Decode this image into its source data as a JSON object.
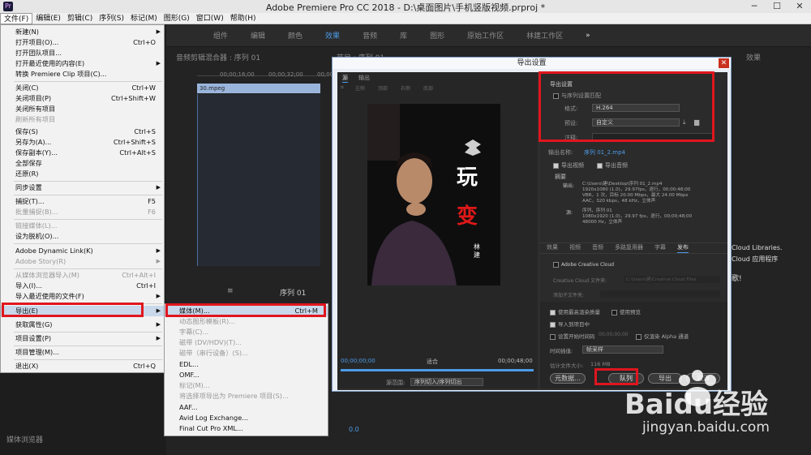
{
  "titlebar": {
    "app_logo": "Pr",
    "title": "Adobe Premiere Pro CC 2018 - D:\\桌面图片\\手机竖版视频.prproj *",
    "minimize": "─",
    "maximize": "☐",
    "close": "✕"
  },
  "menubar": [
    "文件(F)",
    "编辑(E)",
    "剪辑(C)",
    "序列(S)",
    "标记(M)",
    "图形(G)",
    "窗口(W)",
    "帮助(H)"
  ],
  "workspaces": [
    "组件",
    "编辑",
    "颜色",
    "效果",
    "音频",
    "库",
    "图形",
    "原始工作区",
    "林建工作区"
  ],
  "workspace_more": "»",
  "file_menu": [
    {
      "label": "新建(N)",
      "shortcut": "",
      "arrow": true,
      "disabled": false
    },
    {
      "label": "打开项目(O)...",
      "shortcut": "Ctrl+O",
      "arrow": false,
      "disabled": false
    },
    {
      "label": "打开团队项目...",
      "shortcut": "",
      "arrow": false,
      "disabled": false
    },
    {
      "label": "打开最近使用的内容(E)",
      "shortcut": "",
      "arrow": true,
      "disabled": false
    },
    {
      "label": "转换 Premiere Clip 项目(C)...",
      "shortcut": "",
      "arrow": false,
      "disabled": false
    },
    {
      "label": "关闭(C)",
      "shortcut": "Ctrl+W",
      "arrow": false,
      "disabled": false
    },
    {
      "label": "关闭项目(P)",
      "shortcut": "Ctrl+Shift+W",
      "arrow": false,
      "disabled": false
    },
    {
      "label": "关闭所有项目",
      "shortcut": "",
      "arrow": false,
      "disabled": false
    },
    {
      "label": "刷新所有项目",
      "shortcut": "",
      "arrow": false,
      "disabled": true
    },
    {
      "label": "保存(S)",
      "shortcut": "Ctrl+S",
      "arrow": false,
      "disabled": false
    },
    {
      "label": "另存为(A)...",
      "shortcut": "Ctrl+Shift+S",
      "arrow": false,
      "disabled": false
    },
    {
      "label": "保存副本(Y)...",
      "shortcut": "Ctrl+Alt+S",
      "arrow": false,
      "disabled": false
    },
    {
      "label": "全部保存",
      "shortcut": "",
      "arrow": false,
      "disabled": false
    },
    {
      "label": "还原(R)",
      "shortcut": "",
      "arrow": false,
      "disabled": false
    },
    {
      "label": "同步设置",
      "shortcut": "",
      "arrow": true,
      "disabled": false
    },
    {
      "label": "捕捉(T)...",
      "shortcut": "F5",
      "arrow": false,
      "disabled": false
    },
    {
      "label": "批量捕捉(B)...",
      "shortcut": "F6",
      "arrow": false,
      "disabled": true
    },
    {
      "label": "链接媒体(L)...",
      "shortcut": "",
      "arrow": false,
      "disabled": true
    },
    {
      "label": "设为脱机(O)...",
      "shortcut": "",
      "arrow": false,
      "disabled": false
    },
    {
      "label": "Adobe Dynamic Link(K)",
      "shortcut": "",
      "arrow": true,
      "disabled": false
    },
    {
      "label": "Adobe Story(R)",
      "shortcut": "",
      "arrow": true,
      "disabled": true
    },
    {
      "label": "从媒体浏览器导入(M)",
      "shortcut": "Ctrl+Alt+I",
      "arrow": false,
      "disabled": true
    },
    {
      "label": "导入(I)...",
      "shortcut": "Ctrl+I",
      "arrow": false,
      "disabled": false
    },
    {
      "label": "导入最近使用的文件(F)",
      "shortcut": "",
      "arrow": true,
      "disabled": false
    },
    {
      "label": "导出(E)",
      "shortcut": "",
      "arrow": true,
      "disabled": false
    },
    {
      "label": "获取属性(G)",
      "shortcut": "",
      "arrow": true,
      "disabled": false
    },
    {
      "label": "项目设置(P)",
      "shortcut": "",
      "arrow": true,
      "disabled": false
    },
    {
      "label": "项目管理(M)...",
      "shortcut": "",
      "arrow": false,
      "disabled": false
    },
    {
      "label": "退出(X)",
      "shortcut": "Ctrl+Q",
      "arrow": false,
      "disabled": false
    }
  ],
  "export_submenu": [
    {
      "label": "媒体(M)...",
      "shortcut": "Ctrl+M",
      "disabled": false
    },
    {
      "label": "动态图形模板(R)...",
      "shortcut": "",
      "disabled": true
    },
    {
      "label": "字幕(C)...",
      "shortcut": "",
      "disabled": true
    },
    {
      "label": "磁带 (DV/HDV)(T)...",
      "shortcut": "",
      "disabled": true
    },
    {
      "label": "磁带（串行设备）(S)...",
      "shortcut": "",
      "disabled": true
    },
    {
      "label": "EDL...",
      "shortcut": "",
      "disabled": false
    },
    {
      "label": "OMF...",
      "shortcut": "",
      "disabled": false
    },
    {
      "label": "标记(M)...",
      "shortcut": "",
      "disabled": true
    },
    {
      "label": "将选择项导出为 Premiere 项目(S)...",
      "shortcut": "",
      "disabled": true
    },
    {
      "label": "AAF...",
      "shortcut": "",
      "disabled": false
    },
    {
      "label": "Avid Log Exchange...",
      "shortcut": "",
      "disabled": false
    },
    {
      "label": "Final Cut Pro XML...",
      "shortcut": "",
      "disabled": false
    }
  ],
  "audio_mixer": {
    "title": "音频剪辑混合器 : 序列 01",
    "time1": "00;00;16;00",
    "time2": "00;00;32;00",
    "time3": "00;00",
    "clip": "30.mpeg"
  },
  "seq_panel": {
    "tab": "序列 01",
    "menu": "≡",
    "time": "0.0"
  },
  "program_label": "节目 : 序列 01",
  "media_browser": "媒体浏览器",
  "dialog": {
    "title": "导出设置",
    "close": "✕",
    "tabs": [
      "源",
      "输出"
    ],
    "toolbar_items": [
      "左侧",
      "顶部",
      "右侧",
      "底部"
    ],
    "poster_text": {
      "big1": "玩",
      "big2": "变",
      "name": "林建"
    },
    "time_start": "00;00;00;00",
    "fit": "适合",
    "time_end": "00;00;48;00",
    "source_range_label": "源范围:",
    "source_range_value": "序列切入/序列切出",
    "export_settings_header": "导出设置",
    "match_seq": "与序列设置匹配",
    "format_label": "格式:",
    "format_value": "H.264",
    "preset_label": "预设:",
    "preset_value": "自定义",
    "comment_label": "注释:",
    "output_name_label": "输出名称:",
    "output_name_value": "序列 01_2.mp4",
    "export_video": "导出视频",
    "export_audio": "导出音频",
    "summary_label": "摘要",
    "summary_output_label": "输出:",
    "summary_output": [
      "C:\\Users\\建\\Desktop\\序列 01_2.mp4",
      "1920x1080 (1.0)，29.97fps，逐行，00;00;48;00",
      "VBR，1 次，目标 20.00 Mbps，最大 24.00 Mbps",
      "AAC，320 kbps，48 kHz，立体声"
    ],
    "summary_source_label": "源:",
    "summary_source": [
      "序列，序列 01",
      "1080x1920 (1.0)，29.97 fps，逐行，00;00;48;00",
      "48000 Hz，立体声"
    ],
    "settings_tabs": [
      "效果",
      "视频",
      "音频",
      "多路复用器",
      "字幕",
      "发布"
    ],
    "cc_header": "Adobe Creative Cloud",
    "cc_folder_label": "Creative Cloud 文件夹:",
    "cc_folder_value": "C:\\Users\\建\\Creative Cloud Files",
    "cc_subfolder": "添加子文件夹:",
    "opts": [
      "使用最高渲染质量",
      "使用预览",
      "导入到项目中",
      "设置开始时间码",
      "仅渲染 Alpha 通道"
    ],
    "start_tc": "00;00;00;00",
    "interp_label": "时间插值:",
    "interp_value": "帧采样",
    "filesize_label": "估计文件大小:",
    "filesize_value": "116 MB",
    "btn_metadata": "元数据...",
    "btn_queue": "队列",
    "btn_export": "导出",
    "btn_cancel": "取消"
  },
  "right_panel": {
    "title": "效果",
    "cc_lib": "Cloud Libraries.",
    "cc_app": "Cloud 应用程序",
    "hi": "歌!"
  },
  "watermark": {
    "brand": "Baidu经验",
    "url": "jingyan.baidu.com"
  },
  "colors": {
    "accent": "#4c9be8",
    "highlight_red": "#e0161e",
    "dark_bg": "#232323"
  }
}
